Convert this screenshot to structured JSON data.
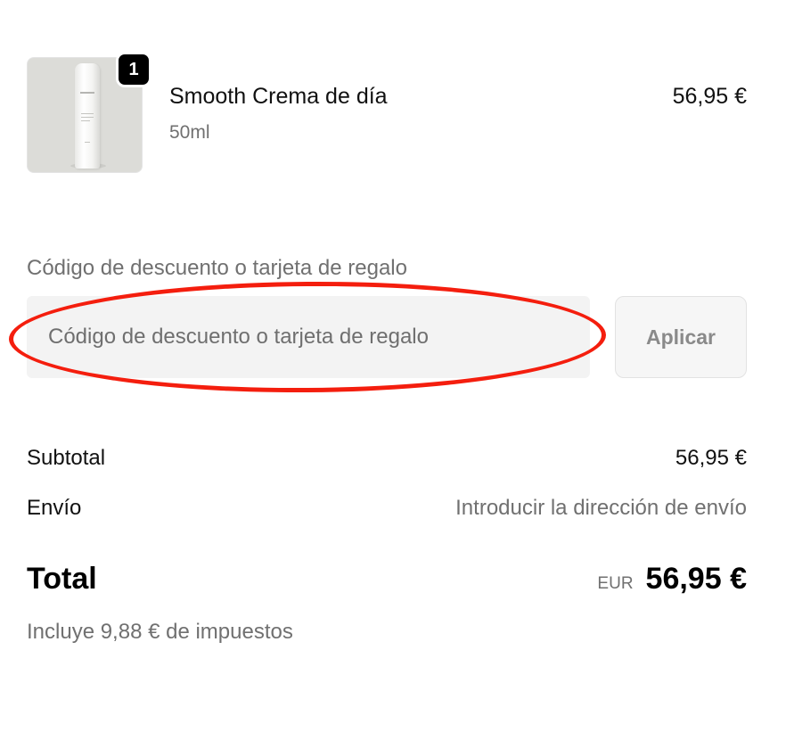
{
  "product": {
    "quantity": "1",
    "name": "Smooth Crema de día",
    "variant": "50ml",
    "price": "56,95 €",
    "image_icon": "cream-tube-product-image"
  },
  "discount": {
    "label": "Código de descuento o tarjeta de regalo",
    "placeholder": "Código de descuento o tarjeta de regalo",
    "value": "",
    "apply_label": "Aplicar"
  },
  "summary": {
    "subtotal_label": "Subtotal",
    "subtotal_value": "56,95 €",
    "shipping_label": "Envío",
    "shipping_value": "Introducir la dirección de envío",
    "total_label": "Total",
    "currency": "EUR",
    "total_value": "56,95 €",
    "taxes_note": "Incluye 9,88 € de impuestos"
  },
  "colors": {
    "highlight": "#f41e0e",
    "badge": "#000000",
    "muted_text": "#707070",
    "input_bg": "#f3f3f3"
  }
}
